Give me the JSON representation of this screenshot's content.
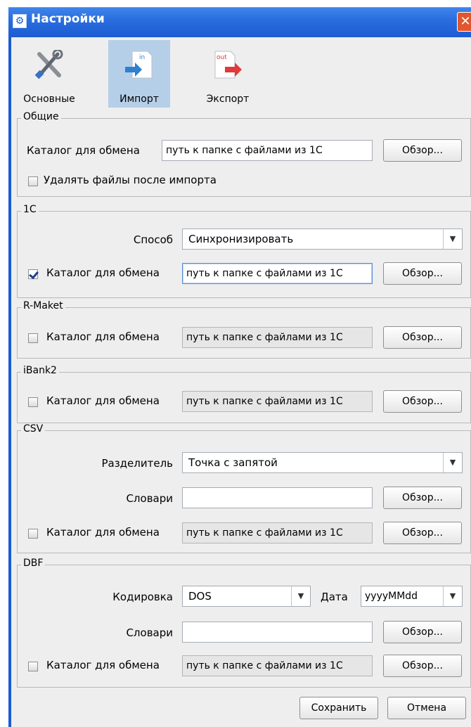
{
  "window": {
    "title": "Настройки",
    "close_glyph": "✕",
    "app_icon": "settings-app-icon"
  },
  "tabs": [
    {
      "label": "Основные",
      "icon": "tools-icon",
      "selected": false
    },
    {
      "label": "Импорт",
      "icon": "import-in-icon",
      "selected": true,
      "icon_text": "in"
    },
    {
      "label": "Экспорт",
      "icon": "export-out-icon",
      "selected": false,
      "icon_text": "out"
    }
  ],
  "browse_label": "Обзор...",
  "general": {
    "legend": "Общие",
    "dir_label": "Каталог для обмена",
    "dir_value": "путь к папке с файлами из 1С",
    "delete_label": "Удалять файлы после импорта",
    "delete_checked": false
  },
  "onec": {
    "legend": "1С",
    "method_label": "Способ",
    "method_value": "Синхронизировать",
    "dir_label": "Каталог для обмена",
    "dir_checked": true,
    "dir_value": "путь к папке с файлами из 1С"
  },
  "rmaket": {
    "legend": "R-Maket",
    "dir_label": "Каталог для обмена",
    "dir_checked": false,
    "dir_value": "путь к папке с файлами из 1С"
  },
  "ibank2": {
    "legend": "iBank2",
    "dir_label": "Каталог для обмена",
    "dir_checked": false,
    "dir_value": "путь к папке с файлами из 1С"
  },
  "csv": {
    "legend": "CSV",
    "separator_label": "Разделитель",
    "separator_value": "Точка с запятой",
    "dict_label": "Словари",
    "dict_value": "",
    "dir_label": "Каталог для обмена",
    "dir_checked": false,
    "dir_value": "путь к папке с файлами из 1С"
  },
  "dbf": {
    "legend": "DBF",
    "encoding_label": "Кодировка",
    "encoding_value": "DOS",
    "date_label": "Дата",
    "date_value": "yyyyMMdd",
    "dict_label": "Словари",
    "dict_value": "",
    "dir_label": "Каталог для обмена",
    "dir_checked": false,
    "dir_value": "путь к папке с файлами из 1С"
  },
  "footer": {
    "save_label": "Сохранить",
    "cancel_label": "Отмена"
  },
  "colors": {
    "titlebar": "#2a6ee0",
    "selected_tab": "#b6cfe9",
    "arrow_in": "#2f7fd0",
    "arrow_out": "#e03a3a"
  }
}
